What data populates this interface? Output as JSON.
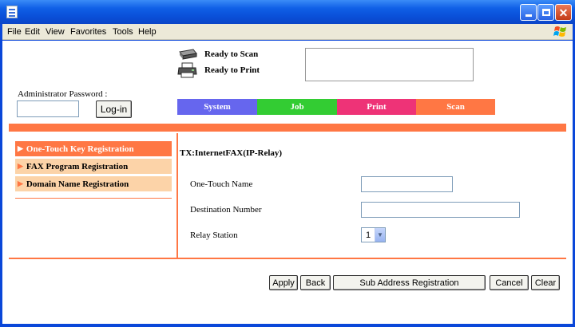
{
  "menu": [
    "File",
    "Edit",
    "View",
    "Favorites",
    "Tools",
    "Help"
  ],
  "status": {
    "scan": "Ready to Scan",
    "print": "Ready to Print"
  },
  "admin": {
    "label": "Administrator Password :",
    "login_label": "Log-in"
  },
  "tabs": [
    "System",
    "Job",
    "Print",
    "Scan"
  ],
  "sidebar": {
    "items": [
      {
        "label": "One-Touch Key Registration",
        "active": true
      },
      {
        "label": "FAX Program Registration",
        "active": false
      },
      {
        "label": "Domain Name Registration",
        "active": false
      }
    ]
  },
  "form": {
    "title": "TX:InternetFAX(IP-Relay)",
    "one_touch_name_label": "One-Touch Name",
    "one_touch_name_value": "",
    "destination_number_label": "Destination Number",
    "destination_number_value": "",
    "relay_station_label": "Relay Station",
    "relay_station_value": "1"
  },
  "buttons": {
    "apply": "Apply",
    "back": "Back",
    "sub_address": "Sub Address Registration",
    "cancel": "Cancel",
    "clear": "Clear"
  },
  "colors": {
    "accent": "#ff7744",
    "tab_system": "#6666ee",
    "tab_job": "#33cc33",
    "tab_print": "#ee3377",
    "tab_scan": "#ff7744",
    "sidebar_inactive": "#fcd3a8"
  }
}
